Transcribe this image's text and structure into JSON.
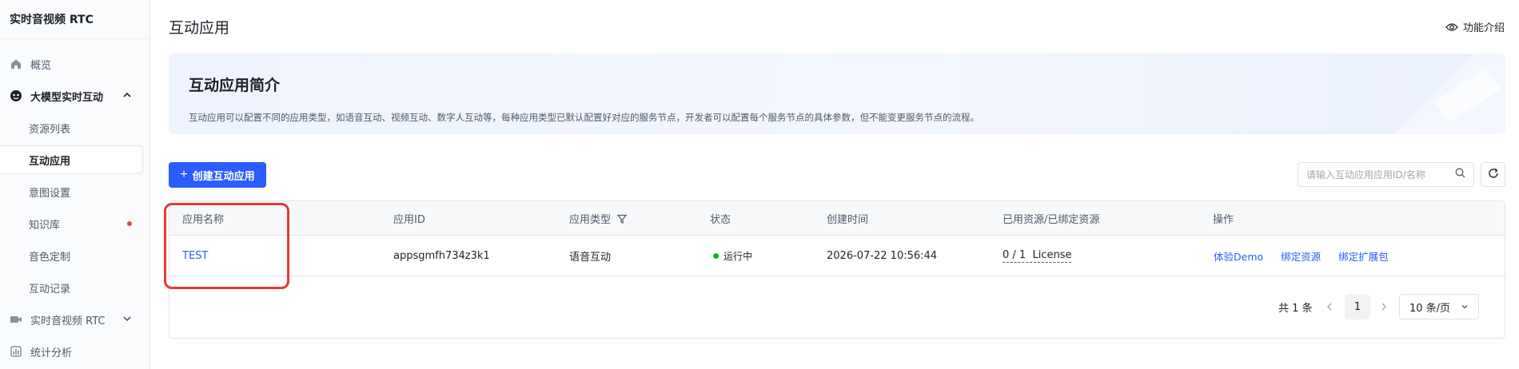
{
  "sidebar": {
    "brand": "实时音视频 RTC",
    "items": [
      {
        "label": "概览"
      },
      {
        "label": "大模型实时互动"
      },
      {
        "label": "资源列表"
      },
      {
        "label": "互动应用"
      },
      {
        "label": "意图设置"
      },
      {
        "label": "知识库"
      },
      {
        "label": "音色定制"
      },
      {
        "label": "互动记录"
      },
      {
        "label": "实时音视频 RTC"
      },
      {
        "label": "统计分析"
      }
    ]
  },
  "header": {
    "title": "互动应用",
    "feature_intro": "功能介绍"
  },
  "banner": {
    "title": "互动应用简介",
    "description": "互动应用可以配置不同的应用类型，如语音互动、视频互动、数字人互动等，每种应用类型已默认配置好对应的服务节点，开发者可以配置每个服务节点的具体参数，但不能变更服务节点的流程。"
  },
  "toolbar": {
    "create_label": "创建互动应用",
    "search_placeholder": "请输入互动应用应用ID/名称"
  },
  "table": {
    "headers": [
      "应用名称",
      "应用ID",
      "应用类型",
      "状态",
      "创建时间",
      "已用资源/已绑定资源",
      "操作"
    ],
    "rows": [
      {
        "name": "TEST",
        "app_id": "appsgmfh734z3k1",
        "type": "语音互动",
        "status": "运行中",
        "created": "2026-07-22 10:56:44",
        "resources": "0 / 1  License",
        "actions": [
          "体验Demo",
          "绑定资源",
          "绑定扩展包"
        ]
      }
    ]
  },
  "pagination": {
    "total": "共 1 条",
    "current": "1",
    "page_size": "10 条/页"
  },
  "colors": {
    "primary": "#2b5cff",
    "status_running": "#00b42a",
    "alert_dot": "#f53f3f",
    "highlight": "#e53935"
  }
}
